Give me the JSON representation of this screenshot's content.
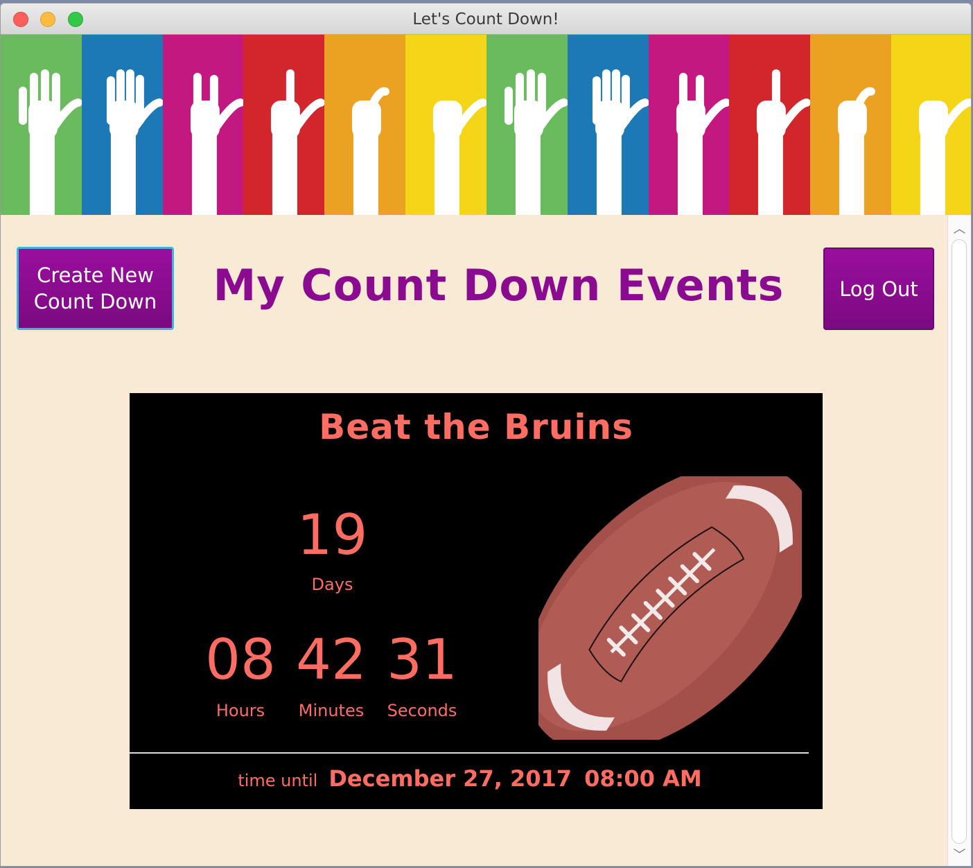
{
  "window": {
    "title": "Let's Count Down!"
  },
  "banner": {
    "stripe_colors": [
      "#6aba5e",
      "#1c79b6",
      "#c2187f",
      "#d1262b",
      "#eba122",
      "#f4d517",
      "#6aba5e",
      "#1c79b6",
      "#c2187f",
      "#d1262b",
      "#eba122",
      "#f4d517"
    ],
    "hand_icons": [
      "open-hand-icon",
      "four-fingers-icon",
      "three-fingers-icon",
      "one-finger-icon",
      "thumb-icon",
      "fist-icon",
      "open-hand-icon",
      "four-fingers-icon",
      "three-fingers-icon",
      "one-finger-icon",
      "thumb-icon",
      "fist-icon"
    ]
  },
  "header": {
    "create_button": "Create New Count Down",
    "title": "My Count Down Events",
    "logout_button": "Log Out"
  },
  "event": {
    "title": "Beat the Bruins",
    "days": "19",
    "days_label": "Days",
    "hours": "08",
    "hours_label": "Hours",
    "minutes": "42",
    "minutes_label": "Minutes",
    "seconds": "31",
    "seconds_label": "Seconds",
    "until_label": "time until",
    "date": "December 27, 2017",
    "time": "08:00 AM",
    "image_icon": "football-icon"
  },
  "colors": {
    "accent_purple": "#8a0b8f",
    "countdown_text": "#ff6d62",
    "page_background": "#f9ead6"
  }
}
